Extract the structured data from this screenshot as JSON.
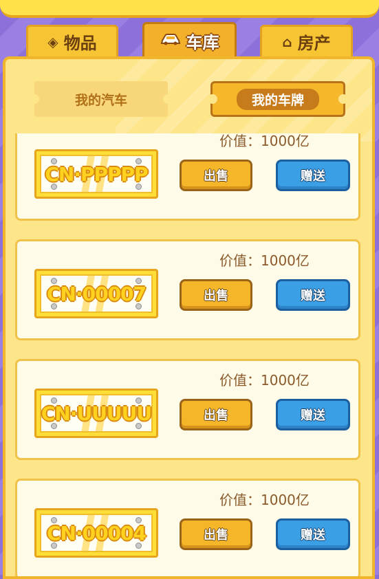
{
  "tabs": [
    {
      "label": "物品",
      "icon": "diamond-icon"
    },
    {
      "label": "车库",
      "icon": "car-icon"
    },
    {
      "label": "房产",
      "icon": "house-icon"
    }
  ],
  "active_tab": "车库",
  "subtabs": [
    {
      "label": "我的汽车"
    },
    {
      "label": "我的车牌"
    }
  ],
  "active_subtab": "我的车牌",
  "plates": [
    {
      "number": "CN·PPPPP",
      "value_label": "价值：1000亿",
      "sell_label": "出售",
      "gift_label": "赠送"
    },
    {
      "number": "CN·00007",
      "value_label": "价值：1000亿",
      "sell_label": "出售",
      "gift_label": "赠送"
    },
    {
      "number": "CN·UUUUU",
      "value_label": "价值：1000亿",
      "sell_label": "出售",
      "gift_label": "赠送"
    },
    {
      "number": "CN·00004",
      "value_label": "价值：1000亿",
      "sell_label": "出售",
      "gift_label": "赠送"
    }
  ],
  "colors": {
    "accent": "#f6b62a",
    "gift": "#3b9fe6",
    "background": "#8b6fd8"
  }
}
